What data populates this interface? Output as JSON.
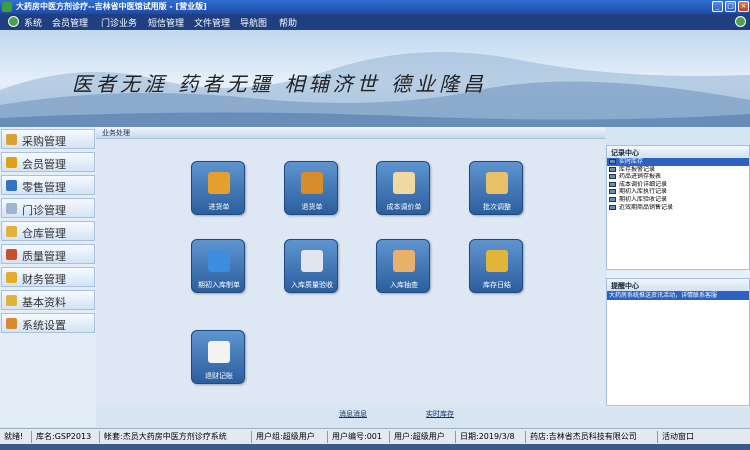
{
  "window": {
    "title": "大药房中医方剂诊疗--吉林省中医馆试用版 - [营业版]",
    "controls": [
      "_",
      "□",
      "×"
    ]
  },
  "menu": {
    "items": [
      "系统",
      "会员管理",
      "门诊业务",
      "短信管理",
      "文件管理",
      "导航图",
      "帮助"
    ]
  },
  "banner": {
    "slogan": "医者无涯  药者无疆  相辅济世  德业隆昌"
  },
  "sidebar": {
    "items": [
      {
        "label": "采购管理",
        "icon": "purchase-icon",
        "color": "#d9a233"
      },
      {
        "label": "会员管理",
        "icon": "member-icon",
        "color": "#e0a019"
      },
      {
        "label": "零售管理",
        "icon": "retail-icon",
        "color": "#2f72c6"
      },
      {
        "label": "门诊管理",
        "icon": "clinic-icon",
        "color": "#9fb3cf"
      },
      {
        "label": "仓库管理",
        "icon": "warehouse-icon",
        "color": "#e3b13a"
      },
      {
        "label": "质量管理",
        "icon": "quality-icon",
        "color": "#c9502f"
      },
      {
        "label": "财务管理",
        "icon": "finance-icon",
        "color": "#e2ae2c"
      },
      {
        "label": "基本资料",
        "icon": "basic-info-icon",
        "color": "#e0b43c"
      },
      {
        "label": "系统设置",
        "icon": "settings-icon",
        "color": "#d8892e"
      }
    ]
  },
  "main": {
    "header": "业务处理",
    "tiles": [
      {
        "label": "进货单",
        "icon": "purchase-order-icon",
        "color": "#e4a02c"
      },
      {
        "label": "退货单",
        "icon": "return-order-icon",
        "color": "#d88d2a"
      },
      {
        "label": "成本调价单",
        "icon": "cost-adjust-icon",
        "color": "#f1d9a4"
      },
      {
        "label": "批次调整",
        "icon": "batch-adjust-icon",
        "color": "#e7c068"
      },
      {
        "label": "期初入库制单",
        "icon": "initial-stock-icon",
        "color": "#3e8ee0"
      },
      {
        "label": "入库质量验收",
        "icon": "quality-check-icon",
        "color": "#dfe6ef"
      },
      {
        "label": "入库抽查",
        "icon": "spot-check-icon",
        "color": "#e8b06a"
      },
      {
        "label": "库存日结",
        "icon": "daily-close-icon",
        "color": "#e3b43a"
      },
      {
        "label": "退财记账",
        "icon": "accounting-icon",
        "color": "#f3f3f3"
      }
    ],
    "footer_links": [
      "消息消息",
      "实时库存"
    ]
  },
  "records": {
    "title": "记录中心",
    "items": [
      "实时库存",
      "库存报警记录",
      "药品进销存报表",
      "成本调价详细记录",
      "期初入库执行记录",
      "期初入库验收记录",
      "近效期商品销售记录"
    ],
    "selected": 0
  },
  "reminders": {
    "title": "提醒中心",
    "items": [
      "大药房系统推送资讯活动，详情联系客服"
    ]
  },
  "status": {
    "cells": [
      "就绪!",
      "库名:GSP2013",
      "帐套:杰员大药房中医方剂诊疗系统",
      "用户组:超级用户",
      "用户编号:001",
      "用户:超级用户",
      "日期:2019/3/8",
      "药店:吉林省杰员科技有限公司",
      "活动窗口"
    ]
  }
}
